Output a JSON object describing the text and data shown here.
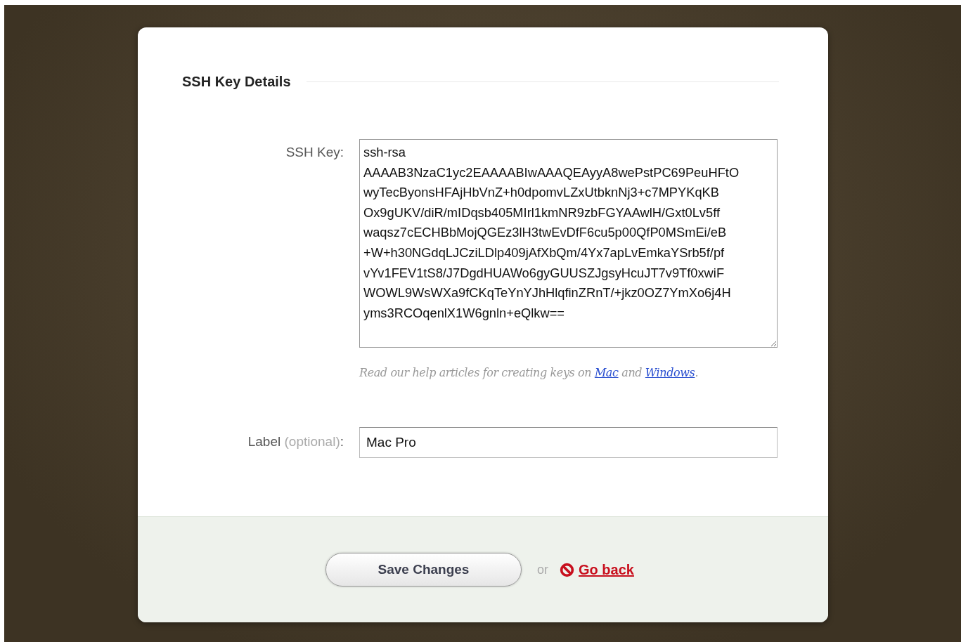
{
  "section_title": "SSH Key Details",
  "ssh_key": {
    "label": "SSH Key:",
    "value_lines": [
      "ssh-rsa",
      "AAAAB3NzaC1yc2EAAAABIwAAAQEAyyA8wePstPC69PeuHFtO",
      "wyTecByonsHFAjHbVnZ+h0dpomvLZxUtbknNj3+c7MPYKqKB",
      "Ox9gUKV/diR/mIDqsb405MIrl1kmNR9zbFGYAAwlH/Gxt0Lv5ff",
      "waqsz7cECHBbMojQGEz3lH3twEvDfF6cu5p00QfP0MSmEi/eB",
      "+W+h30NGdqLJCziLDlp409jAfXbQm/4Yx7apLvEmkaYSrb5f/pf",
      "vYv1FEV1tS8/J7DgdHUAWo6gyGUUSZJgsyHcuJT7v9Tf0xwiF",
      "WOWL9WsWXa9fCKqTeYnYJhHlqfinZRnT/+jkz0OZ7YmXo6j4H",
      "yms3RCOqenlX1W6gnln+eQlkw=="
    ]
  },
  "help": [
    {
      "kind": "text",
      "text": "Read our help articles for creating keys on "
    },
    {
      "kind": "link",
      "text": "Mac"
    },
    {
      "kind": "text",
      "text": " and "
    },
    {
      "kind": "link",
      "text": "Windows"
    },
    {
      "kind": "text",
      "text": "."
    }
  ],
  "label_field": {
    "label": "Label",
    "hint": "(optional)",
    "colon": ":",
    "value": "Mac Pro"
  },
  "footer": {
    "save": "Save Changes",
    "or": "or",
    "back": "Go back"
  }
}
